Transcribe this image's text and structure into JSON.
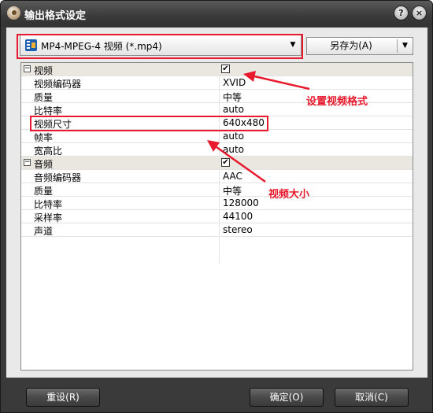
{
  "window": {
    "title": "输出格式设定"
  },
  "title_buttons": {
    "help": "?",
    "close": "×"
  },
  "format_combo": {
    "selected": "MP4-MPEG-4 视频 (*.mp4)",
    "icon": "film-icon"
  },
  "save_as_button": {
    "label": "另存为(A)"
  },
  "video_group": {
    "label": "视频",
    "enabled": true,
    "rows": [
      {
        "name": "视频编码器",
        "value": "XVID"
      },
      {
        "name": "质量",
        "value": "中等"
      },
      {
        "name": "比特率",
        "value": "auto"
      },
      {
        "name": "视频尺寸",
        "value": "640x480"
      },
      {
        "name": "帧率",
        "value": "auto"
      },
      {
        "name": "宽高比",
        "value": "auto"
      }
    ]
  },
  "audio_group": {
    "label": "音频",
    "enabled": true,
    "rows": [
      {
        "name": "音频编码器",
        "value": "AAC"
      },
      {
        "name": "质量",
        "value": "中等"
      },
      {
        "name": "比特率",
        "value": "128000"
      },
      {
        "name": "采样率",
        "value": "44100"
      },
      {
        "name": "声道",
        "value": "stereo"
      }
    ]
  },
  "buttons": {
    "reset": "重设(R)",
    "ok": "确定(O)",
    "cancel": "取消(C)"
  },
  "annotations": {
    "format_note": "设置视频格式",
    "size_note": "视频大小",
    "color": "#e8192c"
  }
}
